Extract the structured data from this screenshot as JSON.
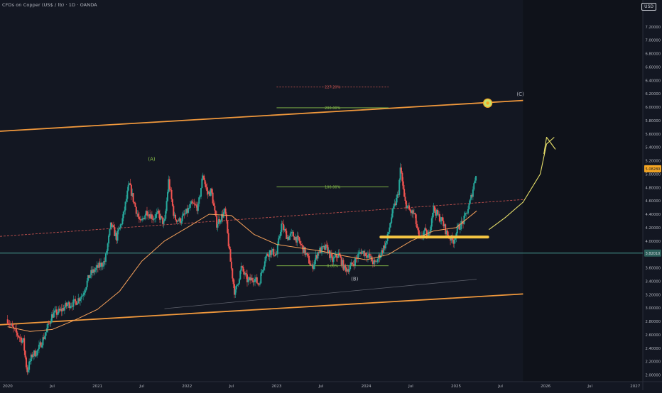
{
  "header": {
    "title": "CFDs on Copper (US$ / lb) · 1D · OANDA",
    "currency_label": "USD"
  },
  "colors": {
    "background": "#131722",
    "up": "#26a69a",
    "down": "#ef5350",
    "channel": "#f0983c",
    "ma": "#f5a05a",
    "fib": "#8bc34a",
    "fib_ext": "#c0504d",
    "support_zone": "#f5c542",
    "projection": "#e8e06a",
    "current_price_bg": "#f5a623"
  },
  "chart_data": {
    "type": "candlestick",
    "instrument": "CFDs on Copper (US$ / lb)",
    "timeframe": "1D",
    "source": "OANDA",
    "x_range": [
      "2019-12-01",
      "2027-02-01"
    ],
    "y_range": [
      1.9,
      7.6
    ],
    "y_ticks": [
      7.2,
      7.0,
      6.8,
      6.6,
      6.4,
      6.2,
      6.0,
      5.8,
      5.6,
      5.4,
      5.2,
      5.0,
      4.8,
      4.6,
      4.4,
      4.2,
      4.0,
      3.8,
      3.6,
      3.4,
      3.2,
      3.0,
      2.8,
      2.6,
      2.4,
      2.2,
      2.0
    ],
    "y_tick_labels": [
      "7.20000",
      "7.00000",
      "6.80000",
      "6.60000",
      "6.40000",
      "6.20000",
      "6.00000",
      "5.80000",
      "5.60000",
      "5.40000",
      "5.20000",
      "5.00000",
      "4.80000",
      "4.60000",
      "4.40000",
      "4.20000",
      "4.00000",
      "3.80000",
      "3.60000",
      "3.40000",
      "3.20000",
      "3.00000",
      "2.80000",
      "2.60000",
      "2.40000",
      "2.20000",
      "2.00000"
    ],
    "x_ticks": [
      {
        "date": "2020-01-01",
        "label": "2020"
      },
      {
        "date": "2020-07-01",
        "label": "Jul"
      },
      {
        "date": "2021-01-01",
        "label": "2021"
      },
      {
        "date": "2021-07-01",
        "label": "Jul"
      },
      {
        "date": "2022-01-01",
        "label": "2022"
      },
      {
        "date": "2022-07-01",
        "label": "Jul"
      },
      {
        "date": "2023-01-01",
        "label": "2023"
      },
      {
        "date": "2023-07-01",
        "label": "Jul"
      },
      {
        "date": "2024-01-01",
        "label": "2024"
      },
      {
        "date": "2024-07-01",
        "label": "Jul"
      },
      {
        "date": "2025-01-01",
        "label": "2025"
      },
      {
        "date": "2025-07-01",
        "label": "Jul"
      },
      {
        "date": "2026-01-01",
        "label": "2026"
      },
      {
        "date": "2026-07-01",
        "label": "Jul"
      },
      {
        "date": "2027-01-01",
        "label": "2027"
      }
    ],
    "price_path": [
      [
        "2020-01-01",
        2.83
      ],
      [
        "2020-01-20",
        2.7
      ],
      [
        "2020-02-15",
        2.58
      ],
      [
        "2020-03-05",
        2.5
      ],
      [
        "2020-03-20",
        2.05
      ],
      [
        "2020-04-10",
        2.3
      ],
      [
        "2020-05-01",
        2.35
      ],
      [
        "2020-06-01",
        2.6
      ],
      [
        "2020-07-01",
        2.9
      ],
      [
        "2020-08-01",
        2.95
      ],
      [
        "2020-09-01",
        3.05
      ],
      [
        "2020-10-01",
        3.08
      ],
      [
        "2020-11-01",
        3.2
      ],
      [
        "2020-12-01",
        3.5
      ],
      [
        "2021-01-01",
        3.6
      ],
      [
        "2021-02-01",
        3.7
      ],
      [
        "2021-02-25",
        4.25
      ],
      [
        "2021-03-20",
        4.05
      ],
      [
        "2021-04-15",
        4.35
      ],
      [
        "2021-05-10",
        4.85
      ],
      [
        "2021-06-01",
        4.55
      ],
      [
        "2021-06-25",
        4.25
      ],
      [
        "2021-07-20",
        4.45
      ],
      [
        "2021-08-15",
        4.35
      ],
      [
        "2021-09-05",
        4.4
      ],
      [
        "2021-10-01",
        4.25
      ],
      [
        "2021-10-18",
        4.9
      ],
      [
        "2021-11-10",
        4.35
      ],
      [
        "2021-12-01",
        4.3
      ],
      [
        "2021-12-25",
        4.4
      ],
      [
        "2022-01-20",
        4.55
      ],
      [
        "2022-02-15",
        4.5
      ],
      [
        "2022-03-07",
        5.0
      ],
      [
        "2022-03-25",
        4.7
      ],
      [
        "2022-04-10",
        4.75
      ],
      [
        "2022-05-01",
        4.25
      ],
      [
        "2022-06-05",
        4.45
      ],
      [
        "2022-06-25",
        3.75
      ],
      [
        "2022-07-15",
        3.2
      ],
      [
        "2022-08-10",
        3.6
      ],
      [
        "2022-09-05",
        3.4
      ],
      [
        "2022-10-01",
        3.45
      ],
      [
        "2022-10-20",
        3.35
      ],
      [
        "2022-11-15",
        3.75
      ],
      [
        "2022-12-05",
        3.85
      ],
      [
        "2023-01-01",
        3.8
      ],
      [
        "2023-01-20",
        4.25
      ],
      [
        "2023-02-15",
        4.05
      ],
      [
        "2023-03-05",
        4.1
      ],
      [
        "2023-04-01",
        4.0
      ],
      [
        "2023-05-01",
        3.8
      ],
      [
        "2023-05-25",
        3.6
      ],
      [
        "2023-06-20",
        3.85
      ],
      [
        "2023-07-25",
        3.9
      ],
      [
        "2023-08-15",
        3.7
      ],
      [
        "2023-09-10",
        3.8
      ],
      [
        "2023-10-05",
        3.58
      ],
      [
        "2023-10-25",
        3.6
      ],
      [
        "2023-11-15",
        3.7
      ],
      [
        "2023-12-10",
        3.85
      ],
      [
        "2024-01-05",
        3.8
      ],
      [
        "2024-02-05",
        3.65
      ],
      [
        "2024-03-05",
        3.85
      ],
      [
        "2024-03-25",
        4.0
      ],
      [
        "2024-04-15",
        4.4
      ],
      [
        "2024-05-10",
        4.7
      ],
      [
        "2024-05-20",
        5.1
      ],
      [
        "2024-06-05",
        4.6
      ],
      [
        "2024-06-25",
        4.45
      ],
      [
        "2024-07-15",
        4.4
      ],
      [
        "2024-08-05",
        4.0
      ],
      [
        "2024-08-25",
        4.15
      ],
      [
        "2024-09-10",
        4.05
      ],
      [
        "2024-09-30",
        4.5
      ],
      [
        "2024-10-15",
        4.4
      ],
      [
        "2024-11-05",
        4.3
      ],
      [
        "2024-11-25",
        4.1
      ],
      [
        "2024-12-20",
        4.0
      ],
      [
        "2025-01-10",
        4.2
      ],
      [
        "2025-02-01",
        4.3
      ],
      [
        "2025-02-25",
        4.55
      ],
      [
        "2025-03-15",
        4.85
      ],
      [
        "2025-03-26",
        5.08
      ]
    ],
    "moving_average_long": [
      [
        "2020-01-01",
        2.72
      ],
      [
        "2020-04-01",
        2.65
      ],
      [
        "2020-07-01",
        2.68
      ],
      [
        "2020-10-01",
        2.82
      ],
      [
        "2021-01-01",
        2.98
      ],
      [
        "2021-04-01",
        3.25
      ],
      [
        "2021-07-01",
        3.7
      ],
      [
        "2021-10-01",
        4.0
      ],
      [
        "2022-01-01",
        4.2
      ],
      [
        "2022-04-01",
        4.4
      ],
      [
        "2022-07-01",
        4.38
      ],
      [
        "2022-10-01",
        4.1
      ],
      [
        "2023-01-01",
        3.95
      ],
      [
        "2023-04-01",
        3.9
      ],
      [
        "2023-07-01",
        3.85
      ],
      [
        "2023-10-01",
        3.78
      ],
      [
        "2024-01-01",
        3.72
      ],
      [
        "2024-04-01",
        3.8
      ],
      [
        "2024-07-01",
        4.0
      ],
      [
        "2024-10-01",
        4.15
      ],
      [
        "2025-01-01",
        4.2
      ],
      [
        "2025-03-26",
        4.45
      ]
    ],
    "moving_average_slow": [
      [
        "2021-10-01",
        2.99
      ],
      [
        "2025-03-26",
        3.43
      ]
    ],
    "horizontal_line": {
      "value": 3.82
    },
    "channel_upper": [
      [
        "2019-12-01",
        5.64
      ],
      [
        "2025-10-01",
        6.1
      ]
    ],
    "channel_lower": [
      [
        "2019-12-01",
        2.75
      ],
      [
        "2025-10-01",
        3.21
      ]
    ],
    "channel_mid": [
      [
        "2019-12-01",
        4.07
      ],
      [
        "2025-10-01",
        4.62
      ]
    ],
    "fib_retracement": {
      "x_start": "2023-01-01",
      "x_end": "2024-04-01",
      "levels": [
        {
          "label": "100.00%",
          "value": 4.81
        },
        {
          "label": "0.00%",
          "value": 3.63
        }
      ]
    },
    "fib_extension": {
      "x_start": "2023-01-01",
      "x_end": "2024-04-01",
      "levels": [
        {
          "label": "200.00%",
          "value": 5.99
        },
        {
          "label": "227.20%",
          "value": 6.3
        }
      ]
    },
    "support_zone": {
      "x_start": "2024-03-01",
      "x_end": "2025-05-10",
      "value": 4.06
    },
    "target_marker": {
      "date": "2025-05-10",
      "value": 6.06
    },
    "wave_labels": [
      {
        "label": "(A)",
        "date": "2021-08-10",
        "value": 5.23
      },
      {
        "label": "(B)",
        "date": "2023-11-15",
        "value": 3.44
      },
      {
        "label": "(C)",
        "date": "2025-09-20",
        "value": 6.2
      }
    ],
    "projection_path": [
      [
        "2025-05-15",
        4.17
      ],
      [
        "2025-07-20",
        4.35
      ],
      [
        "2025-10-01",
        4.58
      ],
      [
        "2025-12-10",
        5.0
      ],
      [
        "2026-01-05",
        5.45
      ],
      [
        "2026-02-05",
        5.55
      ]
    ],
    "projection_arrowhead": [
      [
        "2025-12-25",
        5.3
      ],
      [
        "2026-01-05",
        5.55
      ],
      [
        "2026-02-10",
        5.37
      ]
    ],
    "current_price": {
      "value": 5.08,
      "label": "5.08280"
    },
    "horizontal_line_price": {
      "value": 3.82,
      "label": "3.82010"
    }
  }
}
